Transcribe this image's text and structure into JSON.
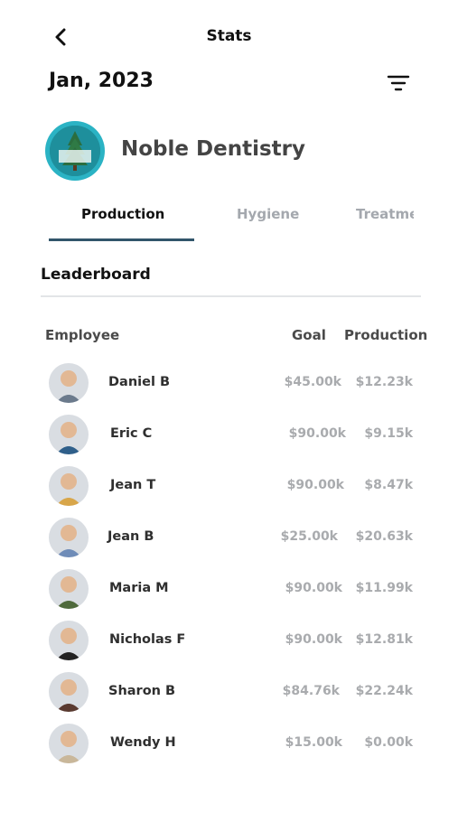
{
  "header": {
    "title": "Stats",
    "back_icon": "chevron-left-icon",
    "filter_icon": "filter-icon"
  },
  "period": {
    "label": "Jan, 2023"
  },
  "practice": {
    "name": "Noble Dentistry",
    "logo_text_top": "NOBLE",
    "logo_text_bottom": "DENTISTRY"
  },
  "tabs": [
    {
      "label": "Production",
      "active": true
    },
    {
      "label": "Hygiene",
      "active": false
    },
    {
      "label": "Treatment",
      "active": false
    }
  ],
  "leaderboard": {
    "title": "Leaderboard",
    "columns": {
      "employee": "Employee",
      "goal": "Goal",
      "production": "Production"
    },
    "rows": [
      {
        "name": "Daniel B",
        "goal": "$45.00k",
        "production": "$12.23k",
        "avatar_color": "#6b7a8c"
      },
      {
        "name": "Eric C",
        "goal": "$90.00k",
        "production": "$9.15k",
        "avatar_color": "#2f5f8a"
      },
      {
        "name": "Jean T",
        "goal": "$90.00k",
        "production": "$8.47k",
        "avatar_color": "#d8a64a"
      },
      {
        "name": "Jean B",
        "goal": "$25.00k",
        "production": "$20.63k",
        "avatar_color": "#6f8cb8"
      },
      {
        "name": "Maria M",
        "goal": "$90.00k",
        "production": "$11.99k",
        "avatar_color": "#4f6a3c"
      },
      {
        "name": "Nicholas F",
        "goal": "$90.00k",
        "production": "$12.81k",
        "avatar_color": "#222222"
      },
      {
        "name": "Sharon B",
        "goal": "$84.76k",
        "production": "$22.24k",
        "avatar_color": "#5a3a30"
      },
      {
        "name": "Wendy H",
        "goal": "$15.00k",
        "production": "$0.00k",
        "avatar_color": "#c9b79a"
      }
    ]
  }
}
